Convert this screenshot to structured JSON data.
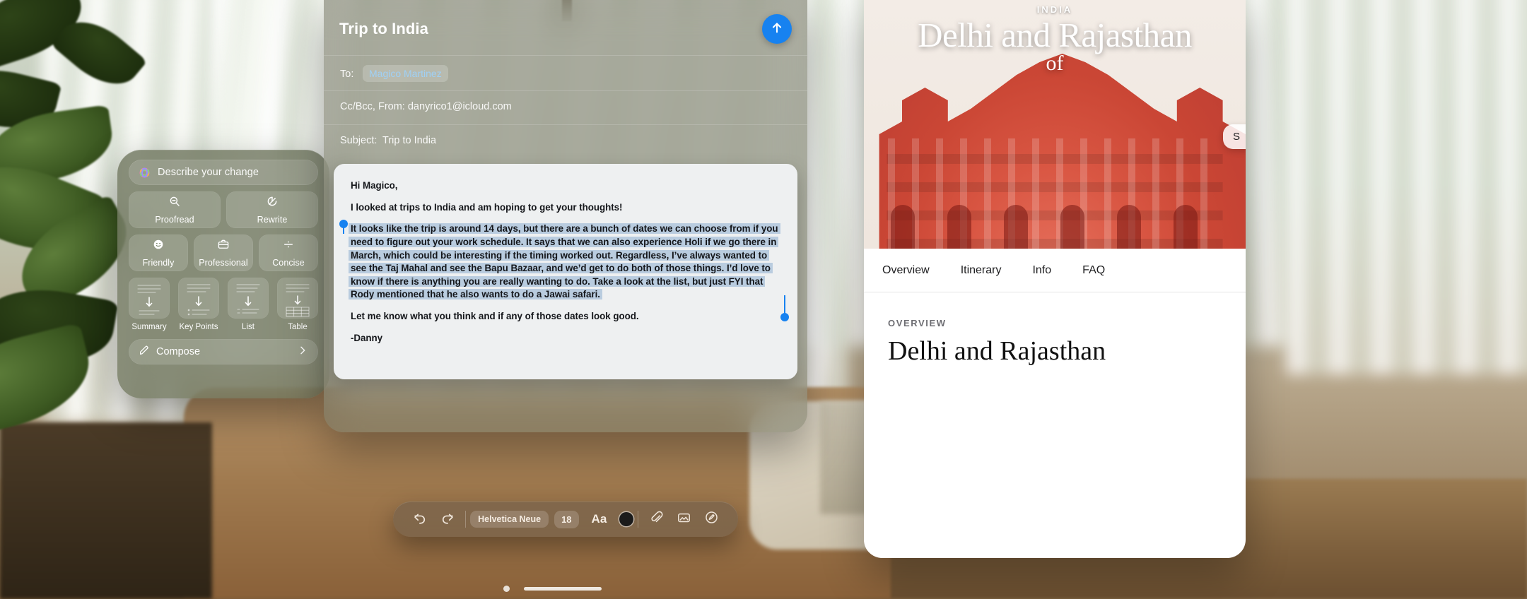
{
  "writing_tools": {
    "describe_placeholder": "Describe your change",
    "siri_icon": "apple-intelligence-icon",
    "actions_row1": [
      {
        "label": "Proofread",
        "icon": "magnifier-minus-icon"
      },
      {
        "label": "Rewrite",
        "icon": "rewrite-circle-icon"
      }
    ],
    "actions_row2": [
      {
        "label": "Friendly",
        "icon": "smiley-face-icon"
      },
      {
        "label": "Professional",
        "icon": "briefcase-icon"
      },
      {
        "label": "Concise",
        "icon": "divide-icon"
      }
    ],
    "formats": [
      {
        "label": "Summary",
        "icon": "summary-card-icon"
      },
      {
        "label": "Key Points",
        "icon": "key-points-card-icon"
      },
      {
        "label": "List",
        "icon": "list-card-icon"
      },
      {
        "label": "Table",
        "icon": "table-card-icon"
      }
    ],
    "compose": {
      "label": "Compose",
      "icon": "pencil-icon",
      "chevron": "chevron-right-icon"
    }
  },
  "mail": {
    "title": "Trip to India",
    "send_icon": "arrow-up-icon",
    "to_label": "To:",
    "to_recipient": "Magico Martinez",
    "ccbcc_from": "Cc/Bcc, From: danyrico1@icloud.com",
    "subject_label": "Subject:",
    "subject_value": "Trip to India",
    "body": {
      "greeting": "Hi Magico,",
      "line1": "I looked at trips to India and am hoping to get your thoughts!",
      "selected": "It looks like the trip is around 14 days, but there are a bunch of dates we can choose from if you need to figure out your work schedule. It says that we can also experience Holi if we go there in March, which could be interesting if the timing worked out. Regardless, I’ve always wanted to see the Taj Mahal and see the Bapu Bazaar, and we’d get to do both of those things.  I’d love to know if there is anything you are really wanting to do. Take a look at the list, but just FYI that Rody mentioned that he also wants to do a Jawai safari.",
      "closing": "Let me know what you think and if any of those dates look good.",
      "signature": "-Danny"
    }
  },
  "format_toolbar": {
    "undo_icon": "undo-arrow-icon",
    "redo_icon": "redo-arrow-icon",
    "font_name": "Helvetica Neue",
    "font_size": "18",
    "text_style_label": "Aa",
    "color_swatch": "#1b1b1b",
    "attach_icon": "paperclip-icon",
    "photo_icon": "photos-icon",
    "markup_icon": "markup-pen-icon"
  },
  "guide": {
    "hero_kicker": "INDIA",
    "hero_title": "Delhi and Rajasthan",
    "hero_subtitle": "of",
    "share_label": "S",
    "tabs": [
      "Overview",
      "Itinerary",
      "Info",
      "FAQ"
    ],
    "overview_kicker": "OVERVIEW",
    "overview_title": "Delhi and Rajasthan"
  },
  "colors": {
    "accent_blue": "#1782f0",
    "selection_blue": "#b9ccdf",
    "panel_green": "rgba(96,103,78,0.72)",
    "toolbar_brown": "rgba(122,100,76,0.78)"
  },
  "system": {
    "home_indicator": "home-indicator"
  }
}
